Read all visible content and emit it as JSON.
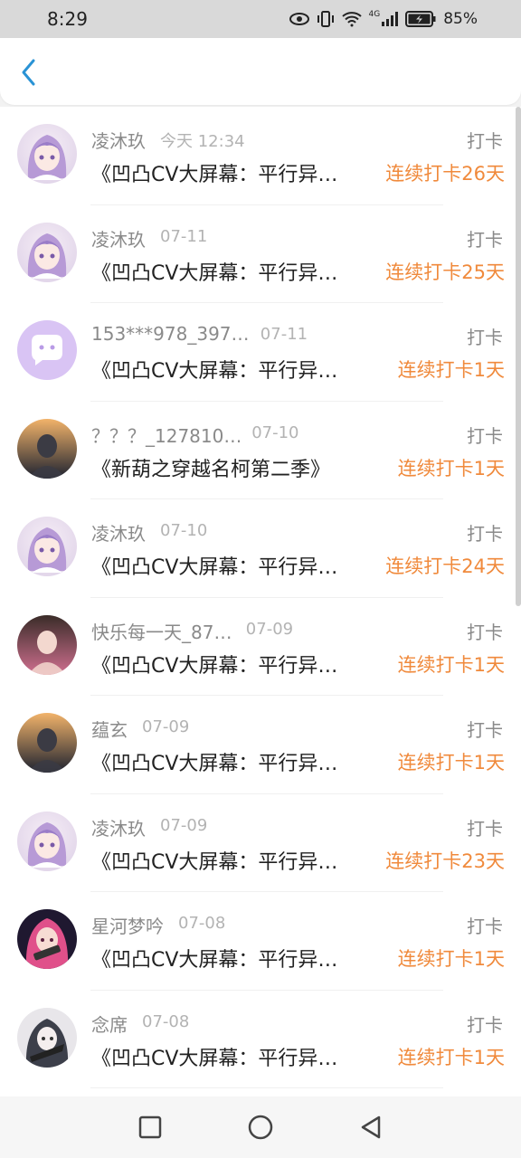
{
  "status_bar": {
    "time": "8:29",
    "network": "4G",
    "battery": "85%"
  },
  "header": {
    "back_icon": "chevron-left-icon",
    "accent": "#2a93d5"
  },
  "colors": {
    "streak": "#f08a3c",
    "meta": "#8a8a8a"
  },
  "rows": [
    {
      "name": "凌沐玖",
      "date": "今天 12:34",
      "action": "打卡",
      "title": "《凹凸CV大屏幕：平行异…",
      "streak": "连续打卡26天",
      "avatar": "anime-purple-hair-avatar"
    },
    {
      "name": "凌沐玖",
      "date": "07-11",
      "action": "打卡",
      "title": "《凹凸CV大屏幕：平行异…",
      "streak": "连续打卡25天",
      "avatar": "anime-purple-hair-avatar"
    },
    {
      "name": "153***978_397…",
      "date": "07-11",
      "action": "打卡",
      "title": "《凹凸CV大屏幕：平行异…",
      "streak": "连续打卡1天",
      "avatar": "default-chat-bubble-avatar"
    },
    {
      "name": "？？？_127810…",
      "date": "07-10",
      "action": "打卡",
      "title": "《新葫之穿越名柯第二季》",
      "streak": "连续打卡1天",
      "avatar": "photo-avatar"
    },
    {
      "name": "凌沐玖",
      "date": "07-10",
      "action": "打卡",
      "title": "《凹凸CV大屏幕：平行异…",
      "streak": "连续打卡24天",
      "avatar": "anime-purple-hair-avatar"
    },
    {
      "name": "快乐每一天_87…",
      "date": "07-09",
      "action": "打卡",
      "title": "《凹凸CV大屏幕：平行异…",
      "streak": "连续打卡1天",
      "avatar": "photo-avatar"
    },
    {
      "name": "蕴玄",
      "date": "07-09",
      "action": "打卡",
      "title": "《凹凸CV大屏幕：平行异…",
      "streak": "连续打卡1天",
      "avatar": "photo-avatar"
    },
    {
      "name": "凌沐玖",
      "date": "07-09",
      "action": "打卡",
      "title": "《凹凸CV大屏幕：平行异…",
      "streak": "连续打卡23天",
      "avatar": "anime-purple-hair-avatar"
    },
    {
      "name": "星河梦吟",
      "date": "07-08",
      "action": "打卡",
      "title": "《凹凸CV大屏幕：平行异…",
      "streak": "连续打卡1天",
      "avatar": "anime-pink-hair-avatar"
    },
    {
      "name": "念席",
      "date": "07-08",
      "action": "打卡",
      "title": "《凹凸CV大屏幕：平行异…",
      "streak": "连续打卡1天",
      "avatar": "anime-dark-avatar"
    }
  ],
  "nav": {
    "recents": "square-icon",
    "home": "circle-icon",
    "back": "triangle-back-icon"
  }
}
